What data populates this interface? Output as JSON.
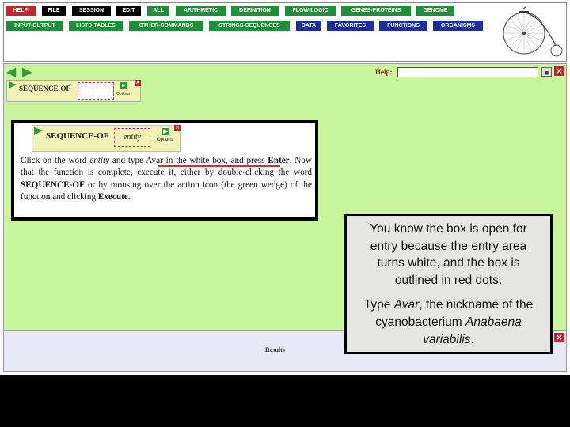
{
  "menu": {
    "row1": [
      {
        "label": "HELP!",
        "color": "#c0282d"
      },
      {
        "label": "FILE",
        "color": "#000000"
      },
      {
        "label": "SESSION",
        "color": "#000000"
      },
      {
        "label": "EDIT",
        "color": "#000000"
      },
      {
        "label": "ALL",
        "color": "#1f8f3a"
      },
      {
        "label": "ARITHMETIC",
        "color": "#1f8f3a"
      },
      {
        "label": "DEFINITION",
        "color": "#1f8f3a"
      },
      {
        "label": "FLOW-LOGIC",
        "color": "#1f8f3a"
      },
      {
        "label": "GENES-PROTEINS",
        "color": "#1f8f3a"
      },
      {
        "label": "GENOME",
        "color": "#1f8f3a"
      }
    ],
    "row2": [
      {
        "label": "INPUT-OUTPUT",
        "color": "#1f8f3a"
      },
      {
        "label": "LISTS-TABLES",
        "color": "#1f8f3a"
      },
      {
        "label": "OTHER-COMMANDS",
        "color": "#1f8f3a"
      },
      {
        "label": "STRINGS-SEQUENCES",
        "color": "#1f8f3a"
      },
      {
        "label": "DATA",
        "color": "#1b2f9c"
      },
      {
        "label": "FAVORITES",
        "color": "#1b2f9c"
      },
      {
        "label": "FUNCTIONS",
        "color": "#1b2f9c"
      },
      {
        "label": "ORGANISMS",
        "color": "#1b2f9c"
      }
    ]
  },
  "help": {
    "label": "Help:",
    "value": ""
  },
  "workspace": {
    "small_box_title": "SEQUENCE-OF",
    "small_box_options": "Options"
  },
  "tutorial": {
    "title": "SEQUENCE-OF",
    "entry": "entity",
    "options": "Options",
    "text_parts": {
      "p1": "Click on the word ",
      "entity": "entity",
      "p2": " and ",
      "type_avar": "type Avar in the white box,",
      "p3": " and press ",
      "enter": "Enter",
      "p4": ". Now that the function is complete, execute it, either by double-clicking the word ",
      "seqof": "SEQUENCE-OF",
      "p5": " or by mousing over the action icon (the green wedge) of the function and clicking ",
      "execute": "Execute",
      "p6": "."
    }
  },
  "callout": {
    "para1": "You know the box is open for entry because the entry area turns white, and the box is outlined in red dots.",
    "para2_pre": "Type ",
    "para2_avar": "Avar",
    "para2_mid": ", the nickname of the cyanobacterium ",
    "para2_species": "Anabaena variabilis",
    "para2_end": "."
  },
  "results": {
    "label": "Results"
  }
}
